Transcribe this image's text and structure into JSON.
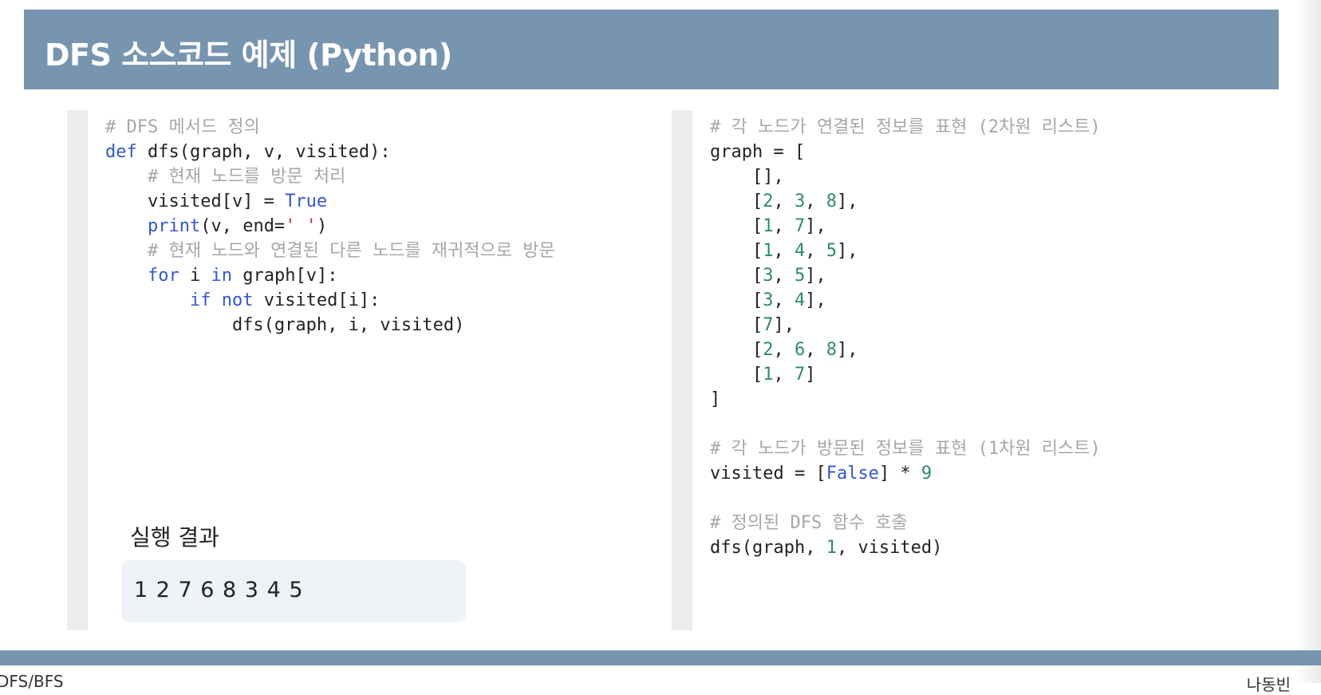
{
  "slide": {
    "title": "DFS 소스코드 예제 (Python)"
  },
  "left_code": [
    {
      "segments": [
        {
          "t": "# DFS 메서드 정의",
          "c": "comment"
        }
      ]
    },
    {
      "segments": [
        {
          "t": "def",
          "c": "kw"
        },
        {
          "t": " dfs(graph, v, visited):",
          "c": ""
        }
      ]
    },
    {
      "segments": [
        {
          "t": "    ",
          "c": ""
        },
        {
          "t": "# 현재 노드를 방문 처리",
          "c": "comment"
        }
      ]
    },
    {
      "segments": [
        {
          "t": "    visited[v] = ",
          "c": ""
        },
        {
          "t": "True",
          "c": "kw"
        }
      ]
    },
    {
      "segments": [
        {
          "t": "    ",
          "c": ""
        },
        {
          "t": "print",
          "c": "kw"
        },
        {
          "t": "(v, end=",
          "c": ""
        },
        {
          "t": "' '",
          "c": "str"
        },
        {
          "t": ")",
          "c": ""
        }
      ]
    },
    {
      "segments": [
        {
          "t": "    ",
          "c": ""
        },
        {
          "t": "# 현재 노드와 연결된 다른 노드를 재귀적으로 방문",
          "c": "comment"
        }
      ]
    },
    {
      "segments": [
        {
          "t": "    ",
          "c": ""
        },
        {
          "t": "for",
          "c": "kw"
        },
        {
          "t": " i ",
          "c": ""
        },
        {
          "t": "in",
          "c": "kw"
        },
        {
          "t": " graph[v]:",
          "c": ""
        }
      ]
    },
    {
      "segments": [
        {
          "t": "        ",
          "c": ""
        },
        {
          "t": "if not",
          "c": "kw"
        },
        {
          "t": " visited[i]:",
          "c": ""
        }
      ]
    },
    {
      "segments": [
        {
          "t": "            dfs(graph, i, visited)",
          "c": ""
        }
      ]
    }
  ],
  "right_code": [
    {
      "segments": [
        {
          "t": "# 각 노드가 연결된 정보를 표현 (2차원 리스트)",
          "c": "comment"
        }
      ]
    },
    {
      "segments": [
        {
          "t": "graph = [",
          "c": ""
        }
      ]
    },
    {
      "segments": [
        {
          "t": "    [],",
          "c": ""
        }
      ]
    },
    {
      "segments": [
        {
          "t": "    [",
          "c": ""
        },
        {
          "t": "2",
          "c": "num"
        },
        {
          "t": ", ",
          "c": ""
        },
        {
          "t": "3",
          "c": "num"
        },
        {
          "t": ", ",
          "c": ""
        },
        {
          "t": "8",
          "c": "num"
        },
        {
          "t": "],",
          "c": ""
        }
      ]
    },
    {
      "segments": [
        {
          "t": "    [",
          "c": ""
        },
        {
          "t": "1",
          "c": "num"
        },
        {
          "t": ", ",
          "c": ""
        },
        {
          "t": "7",
          "c": "num"
        },
        {
          "t": "],",
          "c": ""
        }
      ]
    },
    {
      "segments": [
        {
          "t": "    [",
          "c": ""
        },
        {
          "t": "1",
          "c": "num"
        },
        {
          "t": ", ",
          "c": ""
        },
        {
          "t": "4",
          "c": "num"
        },
        {
          "t": ", ",
          "c": ""
        },
        {
          "t": "5",
          "c": "num"
        },
        {
          "t": "],",
          "c": ""
        }
      ]
    },
    {
      "segments": [
        {
          "t": "    [",
          "c": ""
        },
        {
          "t": "3",
          "c": "num"
        },
        {
          "t": ", ",
          "c": ""
        },
        {
          "t": "5",
          "c": "num"
        },
        {
          "t": "],",
          "c": ""
        }
      ]
    },
    {
      "segments": [
        {
          "t": "    [",
          "c": ""
        },
        {
          "t": "3",
          "c": "num"
        },
        {
          "t": ", ",
          "c": ""
        },
        {
          "t": "4",
          "c": "num"
        },
        {
          "t": "],",
          "c": ""
        }
      ]
    },
    {
      "segments": [
        {
          "t": "    [",
          "c": ""
        },
        {
          "t": "7",
          "c": "num"
        },
        {
          "t": "],",
          "c": ""
        }
      ]
    },
    {
      "segments": [
        {
          "t": "    [",
          "c": ""
        },
        {
          "t": "2",
          "c": "num"
        },
        {
          "t": ", ",
          "c": ""
        },
        {
          "t": "6",
          "c": "num"
        },
        {
          "t": ", ",
          "c": ""
        },
        {
          "t": "8",
          "c": "num"
        },
        {
          "t": "],",
          "c": ""
        }
      ]
    },
    {
      "segments": [
        {
          "t": "    [",
          "c": ""
        },
        {
          "t": "1",
          "c": "num"
        },
        {
          "t": ", ",
          "c": ""
        },
        {
          "t": "7",
          "c": "num"
        },
        {
          "t": "]",
          "c": ""
        }
      ]
    },
    {
      "segments": [
        {
          "t": "]",
          "c": ""
        }
      ]
    },
    {
      "segments": [
        {
          "t": "",
          "c": ""
        }
      ]
    },
    {
      "segments": [
        {
          "t": "# 각 노드가 방문된 정보를 표현 (1차원 리스트)",
          "c": "comment"
        }
      ]
    },
    {
      "segments": [
        {
          "t": "visited = [",
          "c": ""
        },
        {
          "t": "False",
          "c": "kw"
        },
        {
          "t": "] * ",
          "c": ""
        },
        {
          "t": "9",
          "c": "num"
        }
      ]
    },
    {
      "segments": [
        {
          "t": "",
          "c": ""
        }
      ]
    },
    {
      "segments": [
        {
          "t": "# 정의된 DFS 함수 호출",
          "c": "comment"
        }
      ]
    },
    {
      "segments": [
        {
          "t": "dfs(graph, ",
          "c": ""
        },
        {
          "t": "1",
          "c": "num"
        },
        {
          "t": ", visited)",
          "c": ""
        }
      ]
    }
  ],
  "result": {
    "label": "실행 결과",
    "value": "1 2 7 6 8 3 4 5"
  },
  "footer": {
    "left": "DFS/BFS",
    "right": "나동빈"
  }
}
